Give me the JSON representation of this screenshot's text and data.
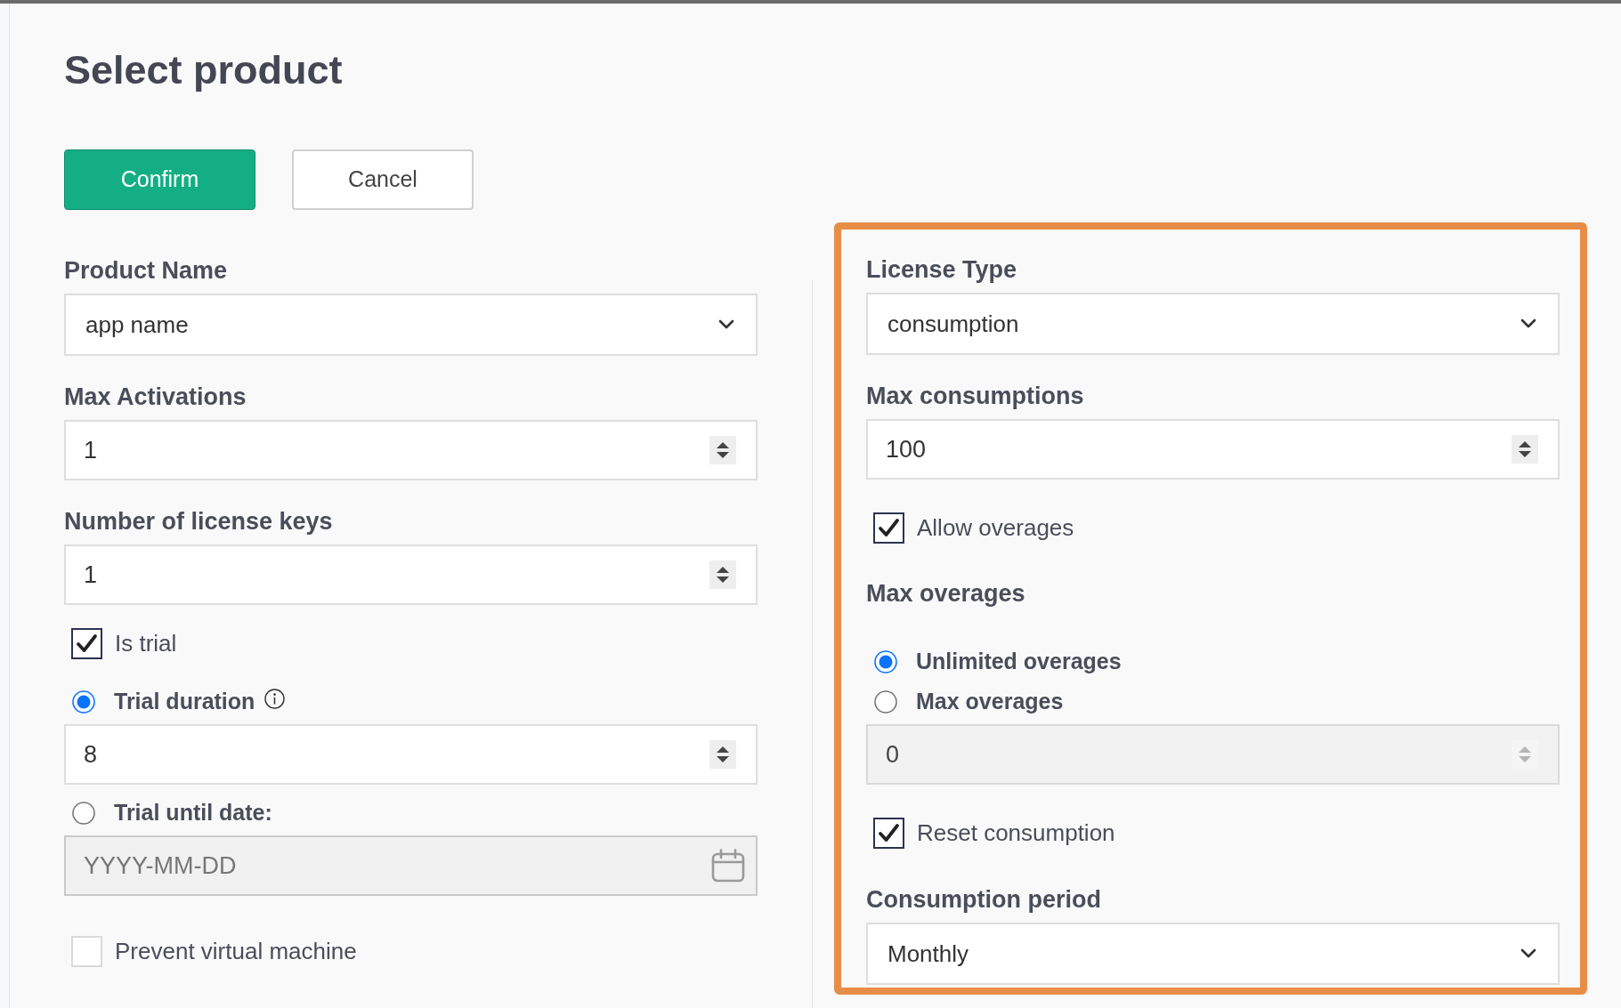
{
  "title": "Select product",
  "actions": [
    {
      "label": "Confirm",
      "kind": "primary"
    },
    {
      "label": "Cancel",
      "kind": "secondary"
    }
  ],
  "product_form": {
    "items": [
      {
        "kind": "select",
        "label": "Product Name",
        "value": "app name"
      },
      {
        "kind": "number",
        "label": "Max Activations",
        "value": "1",
        "disabled": false
      },
      {
        "kind": "number",
        "label": "Number of license keys",
        "value": "1",
        "disabled": false
      },
      {
        "kind": "checkbox",
        "label": "Is trial",
        "checked": true
      },
      {
        "kind": "radio",
        "label": "Trial duration",
        "selected": true,
        "info": true
      },
      {
        "kind": "number",
        "value": "8",
        "disabled": false
      },
      {
        "kind": "radio",
        "label": "Trial until date:",
        "selected": false
      },
      {
        "kind": "date",
        "placeholder": "YYYY-MM-DD",
        "disabled": true
      },
      {
        "kind": "checkbox",
        "label": "Prevent virtual machine",
        "checked": false
      }
    ]
  },
  "license_panel": {
    "highlighted": true,
    "items": [
      {
        "kind": "select",
        "label": "License Type",
        "value": "consumption"
      },
      {
        "kind": "number",
        "label": "Max consumptions",
        "value": "100",
        "disabled": false
      },
      {
        "kind": "checkbox",
        "label": "Allow overages",
        "checked": true
      },
      {
        "kind": "heading",
        "label": "Max overages"
      },
      {
        "kind": "radio",
        "label": "Unlimited overages",
        "selected": true
      },
      {
        "kind": "radio",
        "label": "Max overages",
        "selected": false
      },
      {
        "kind": "number",
        "value": "0",
        "disabled": true
      },
      {
        "kind": "checkbox",
        "label": "Reset consumption",
        "checked": true
      },
      {
        "kind": "select",
        "label": "Consumption period",
        "value": "Monthly"
      }
    ]
  }
}
